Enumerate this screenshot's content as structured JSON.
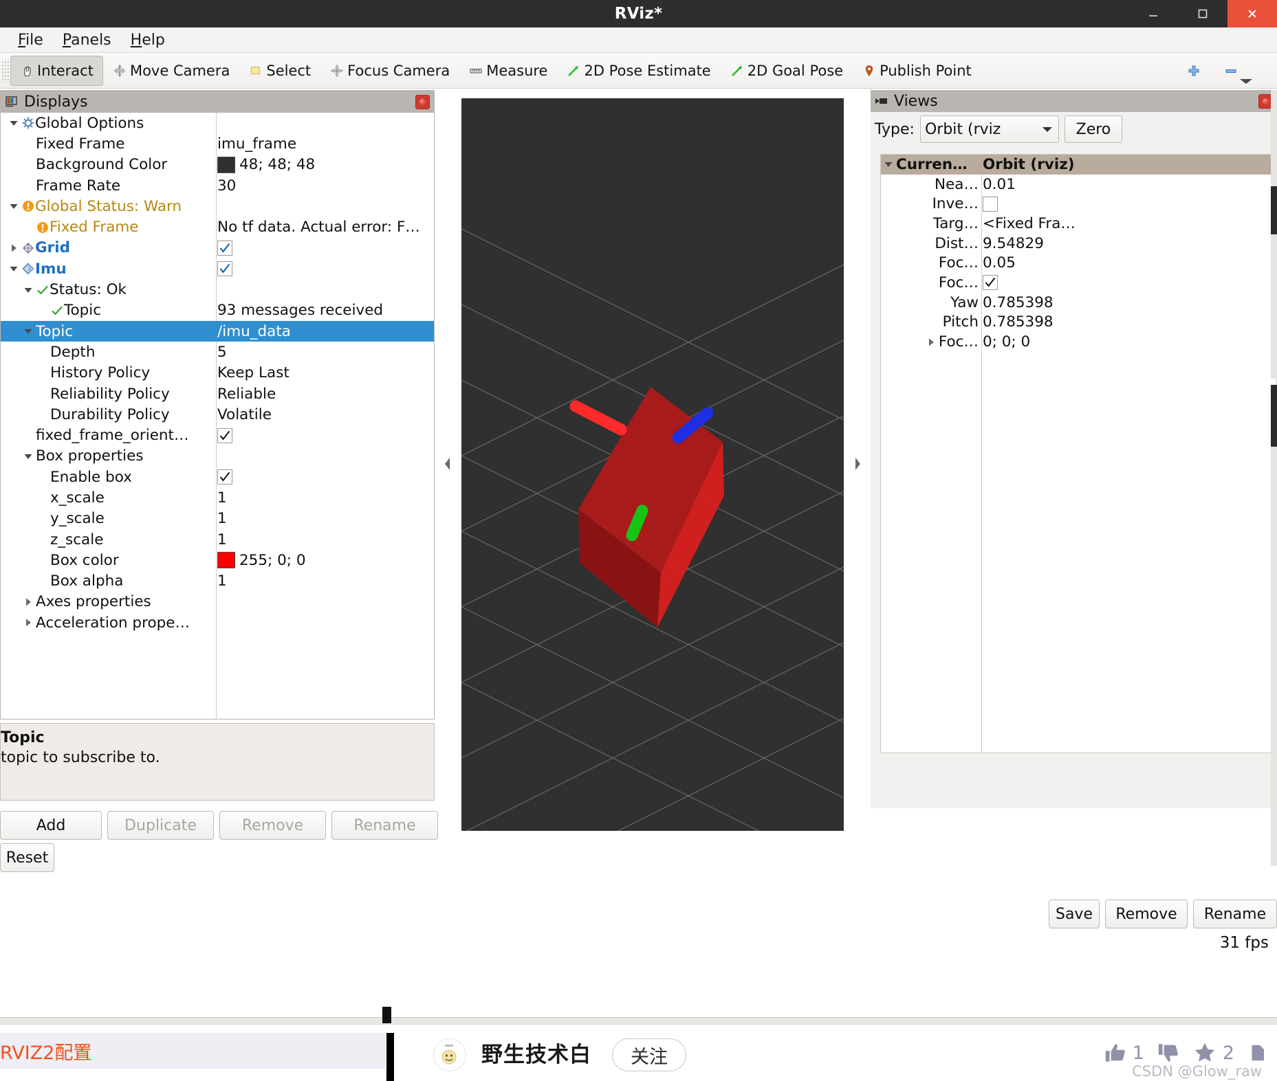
{
  "window": {
    "title": "RViz*",
    "controls": {
      "minimize": "minimize-icon",
      "maximize": "maximize-icon",
      "close": "close-icon"
    }
  },
  "menubar": {
    "items": [
      {
        "label": "File",
        "mnemonic": "F"
      },
      {
        "label": "Panels",
        "mnemonic": "P"
      },
      {
        "label": "Help",
        "mnemonic": "H"
      }
    ]
  },
  "toolbar": {
    "items": [
      {
        "label": "Interact",
        "icon": "hand-cursor-icon",
        "active": true
      },
      {
        "label": "Move Camera",
        "icon": "move-camera-icon",
        "active": false
      },
      {
        "label": "Select",
        "icon": "select-rect-icon",
        "active": false
      },
      {
        "label": "Focus Camera",
        "icon": "focus-camera-icon",
        "active": false
      },
      {
        "label": "Measure",
        "icon": "ruler-icon",
        "active": false
      },
      {
        "label": "2D Pose Estimate",
        "icon": "green-arrow-icon",
        "active": false
      },
      {
        "label": "2D Goal Pose",
        "icon": "green-arrow-icon",
        "active": false
      },
      {
        "label": "Publish Point",
        "icon": "map-pin-icon",
        "active": false
      }
    ],
    "plus_icon": "plus-icon",
    "minus_icon": "minus-icon",
    "overflow_icon": "chevron-down-icon"
  },
  "displays_panel": {
    "title": "Displays",
    "icon": "displays-icon",
    "close_icon": "close-panel-icon",
    "rows": [
      {
        "indent": 0,
        "arrow": "down",
        "icon": "gear-icon",
        "label": "Global Options",
        "style": "normal",
        "value": "",
        "vtype": "text"
      },
      {
        "indent": 1,
        "arrow": "none",
        "icon": "",
        "label": "Fixed Frame",
        "style": "normal",
        "value": "imu_frame",
        "vtype": "text"
      },
      {
        "indent": 1,
        "arrow": "none",
        "icon": "",
        "label": "Background Color",
        "style": "normal",
        "value": "48; 48; 48",
        "vtype": "color",
        "swatch": "#303030"
      },
      {
        "indent": 1,
        "arrow": "none",
        "icon": "",
        "label": "Frame Rate",
        "style": "normal",
        "value": "30",
        "vtype": "text"
      },
      {
        "indent": 0,
        "arrow": "down",
        "icon": "warn-icon",
        "label": "Global Status: Warn",
        "style": "warn",
        "value": "",
        "vtype": "text"
      },
      {
        "indent": 1,
        "arrow": "none",
        "icon": "warn-icon",
        "label": "Fixed Frame",
        "style": "warn",
        "value": "No tf data.  Actual error: F…",
        "vtype": "text"
      },
      {
        "indent": 0,
        "arrow": "right",
        "icon": "grid-icon",
        "label": "Grid",
        "style": "bluebold",
        "value": "",
        "vtype": "check"
      },
      {
        "indent": 0,
        "arrow": "down",
        "icon": "imu-icon",
        "label": "Imu",
        "style": "bluebold",
        "value": "",
        "vtype": "check"
      },
      {
        "indent": 1,
        "arrow": "down",
        "icon": "ok-check-icon",
        "label": "Status: Ok",
        "style": "normal",
        "value": "",
        "vtype": "text"
      },
      {
        "indent": 2,
        "arrow": "none",
        "icon": "ok-check-icon",
        "label": "Topic",
        "style": "normal",
        "value": "93 messages received",
        "vtype": "text"
      },
      {
        "indent": 1,
        "arrow": "down",
        "icon": "",
        "label": "Topic",
        "style": "selected",
        "value": "/imu_data",
        "vtype": "text",
        "selected": true
      },
      {
        "indent": 2,
        "arrow": "none",
        "icon": "",
        "label": "Depth",
        "style": "normal",
        "value": "5",
        "vtype": "text"
      },
      {
        "indent": 2,
        "arrow": "none",
        "icon": "",
        "label": "History Policy",
        "style": "normal",
        "value": "Keep Last",
        "vtype": "text"
      },
      {
        "indent": 2,
        "arrow": "none",
        "icon": "",
        "label": "Reliability Policy",
        "style": "normal",
        "value": "Reliable",
        "vtype": "text"
      },
      {
        "indent": 2,
        "arrow": "none",
        "icon": "",
        "label": "Durability Policy",
        "style": "normal",
        "value": "Volatile",
        "vtype": "text"
      },
      {
        "indent": 1,
        "arrow": "none",
        "icon": "",
        "label": "fixed_frame_orient…",
        "style": "normal",
        "value": "",
        "vtype": "check"
      },
      {
        "indent": 1,
        "arrow": "down",
        "icon": "",
        "label": "Box properties",
        "style": "normal",
        "value": "",
        "vtype": "text"
      },
      {
        "indent": 2,
        "arrow": "none",
        "icon": "",
        "label": "Enable box",
        "style": "normal",
        "value": "",
        "vtype": "check"
      },
      {
        "indent": 2,
        "arrow": "none",
        "icon": "",
        "label": "x_scale",
        "style": "normal",
        "value": "1",
        "vtype": "text"
      },
      {
        "indent": 2,
        "arrow": "none",
        "icon": "",
        "label": "y_scale",
        "style": "normal",
        "value": "1",
        "vtype": "text"
      },
      {
        "indent": 2,
        "arrow": "none",
        "icon": "",
        "label": "z_scale",
        "style": "normal",
        "value": "1",
        "vtype": "text"
      },
      {
        "indent": 2,
        "arrow": "none",
        "icon": "",
        "label": "Box color",
        "style": "normal",
        "value": "255; 0; 0",
        "vtype": "color",
        "swatch": "#ff0000"
      },
      {
        "indent": 2,
        "arrow": "none",
        "icon": "",
        "label": "Box alpha",
        "style": "normal",
        "value": "1",
        "vtype": "text"
      },
      {
        "indent": 1,
        "arrow": "right",
        "icon": "",
        "label": "Axes properties",
        "style": "normal",
        "value": "",
        "vtype": "text"
      },
      {
        "indent": 1,
        "arrow": "right",
        "icon": "",
        "label": "Acceleration prope…",
        "style": "normal",
        "value": "",
        "vtype": "text"
      }
    ]
  },
  "help_box": {
    "title": "Topic",
    "description": "topic to subscribe to."
  },
  "display_buttons": [
    {
      "label": "Add",
      "enabled": true
    },
    {
      "label": "Duplicate",
      "enabled": false
    },
    {
      "label": "Remove",
      "enabled": false
    },
    {
      "label": "Rename",
      "enabled": false
    }
  ],
  "reset_button": {
    "label": "Reset"
  },
  "viewport": {
    "background_color": "#303030",
    "grid_color": "#8a8a8a",
    "box_color": "#cc0000",
    "axis_x_color": "#ff3333",
    "axis_y_color": "#22bb22",
    "axis_z_color": "#2233dd",
    "left_handle_icon": "collapse-left-icon",
    "right_handle_icon": "collapse-right-icon"
  },
  "views_panel": {
    "title": "Views",
    "icon": "views-camera-icon",
    "close_icon": "close-panel-icon",
    "type_label": "Type:",
    "type_value": "Orbit (rviz",
    "type_dropdown_icon": "chevron-down-icon",
    "zero_button": "Zero",
    "rows": [
      {
        "arrow": "down",
        "key": "Curren…",
        "value": "Orbit (rviz)",
        "vtype": "text",
        "header": true
      },
      {
        "arrow": "none",
        "key": "Nea…",
        "value": "0.01",
        "vtype": "text"
      },
      {
        "arrow": "none",
        "key": "Inve…",
        "value": "",
        "vtype": "checkbox-empty"
      },
      {
        "arrow": "none",
        "key": "Targ…",
        "value": "<Fixed Fra…",
        "vtype": "text"
      },
      {
        "arrow": "none",
        "key": "Dist…",
        "value": "9.54829",
        "vtype": "text"
      },
      {
        "arrow": "none",
        "key": "Foc…",
        "value": "0.05",
        "vtype": "text"
      },
      {
        "arrow": "none",
        "key": "Foc…",
        "value": "",
        "vtype": "checkbox-checked"
      },
      {
        "arrow": "none",
        "key": "Yaw",
        "value": "0.785398",
        "vtype": "text"
      },
      {
        "arrow": "none",
        "key": "Pitch",
        "value": "0.785398",
        "vtype": "text"
      },
      {
        "arrow": "right",
        "key": "Foc…",
        "value": "0; 0; 0",
        "vtype": "text"
      }
    ],
    "buttons": [
      {
        "label": "Save"
      },
      {
        "label": "Remove"
      },
      {
        "label": "Rename"
      }
    ]
  },
  "status_bar": {
    "fps": "31 fps"
  },
  "bottom_bar": {
    "tab_text": "RVIZ2配置",
    "author_name": "野生技术白",
    "follow_button": "关注",
    "like_icon": "thumbs-up-icon",
    "like_count": "1",
    "dislike_icon": "thumbs-down-icon",
    "star_icon": "star-icon",
    "star_count": "2",
    "watermark": "CSDN @Glow_raw"
  }
}
